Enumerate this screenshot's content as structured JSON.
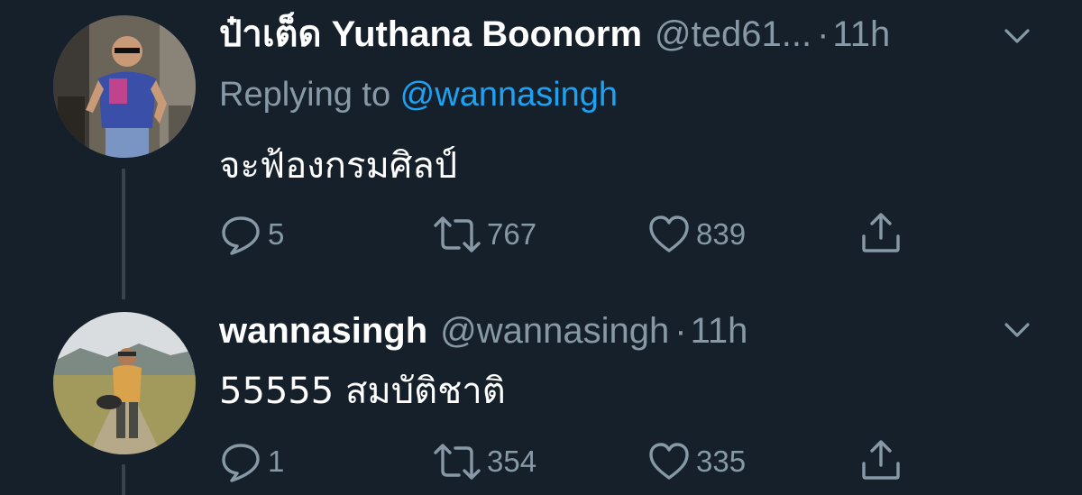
{
  "colors": {
    "background": "#15202b",
    "text_primary": "#ffffff",
    "text_secondary": "#8899a6",
    "link": "#1da1f2",
    "thread_line": "#38444d"
  },
  "tweets": [
    {
      "display_name": "ป๋าเต็ด Yuthana Boonorm",
      "handle": "@ted61...",
      "separator": "·",
      "time": "11h",
      "replying_prefix": "Replying to ",
      "replying_to": "@wannasingh",
      "text": "จะฟ้องกรมศิลป์",
      "reply_count": "5",
      "retweet_count": "767",
      "like_count": "839",
      "icons": [
        "chevron-down-icon",
        "reply-icon",
        "retweet-icon",
        "like-icon",
        "share-icon"
      ]
    },
    {
      "display_name": "wannasingh",
      "handle": "@wannasingh",
      "separator": "·",
      "time": "11h",
      "text": "55555 สมบัติชาติ",
      "reply_count": "1",
      "retweet_count": "354",
      "like_count": "335",
      "icons": [
        "chevron-down-icon",
        "reply-icon",
        "retweet-icon",
        "like-icon",
        "share-icon"
      ]
    }
  ]
}
